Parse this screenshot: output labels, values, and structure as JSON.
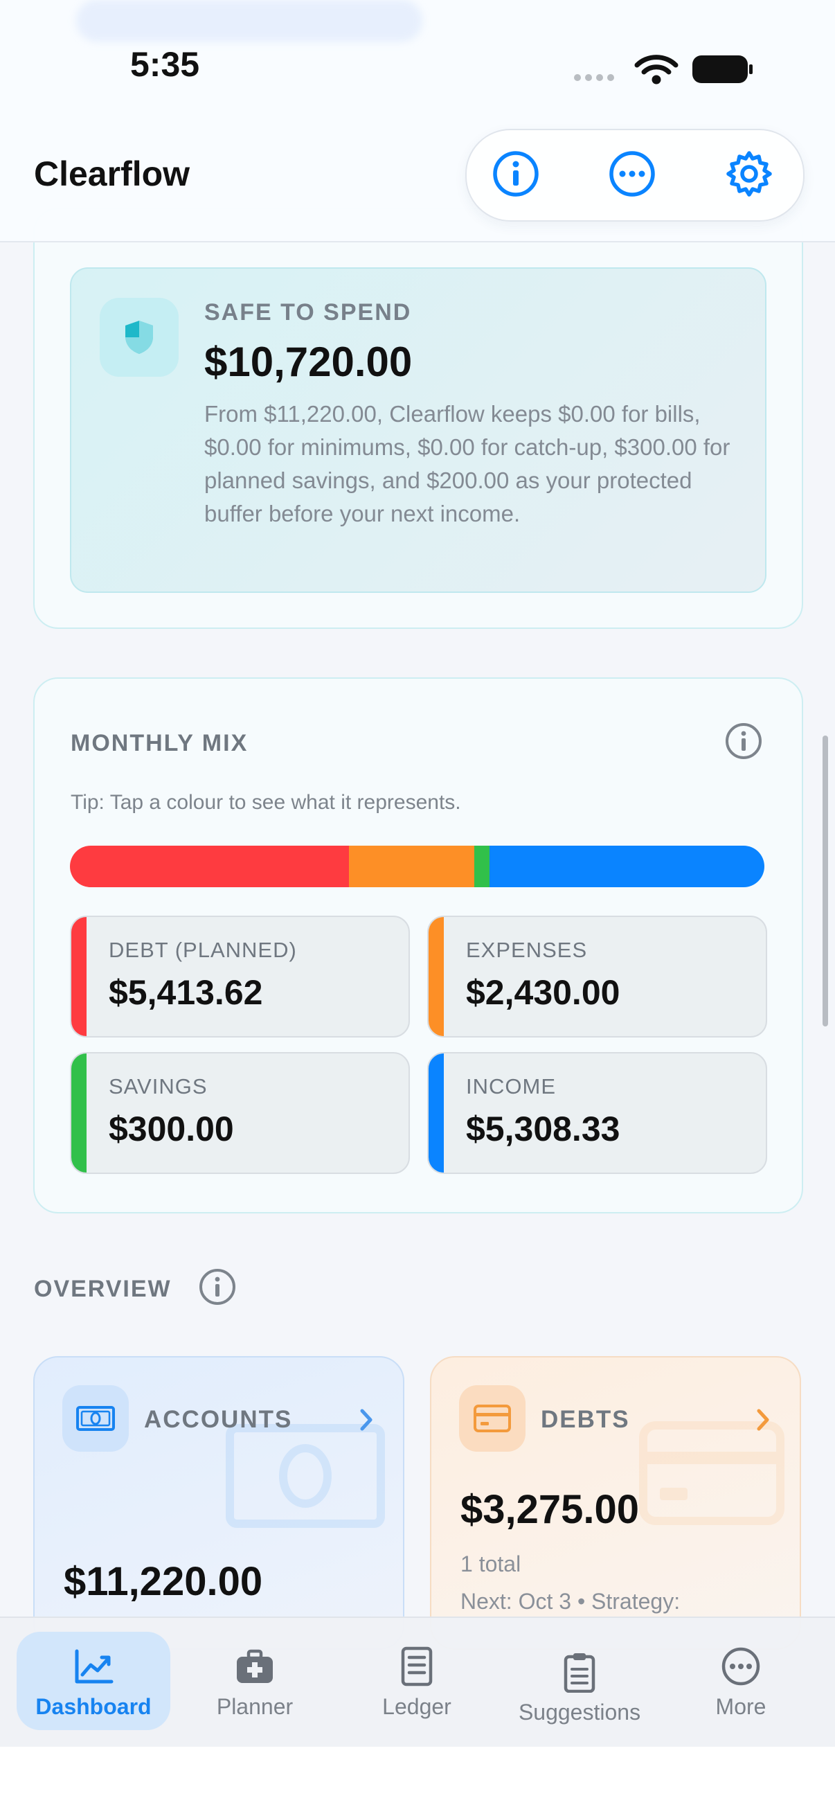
{
  "status_bar": {
    "time": "5:35"
  },
  "header": {
    "title": "Clearflow",
    "buttons": [
      {
        "name": "info",
        "icon": "info-icon"
      },
      {
        "name": "more",
        "icon": "ellipsis-circle-icon"
      },
      {
        "name": "settings",
        "icon": "gear-icon"
      }
    ]
  },
  "safe_to_spend": {
    "label": "SAFE TO SPEND",
    "amount": "$10,720.00",
    "description": "From $11,220.00, Clearflow keeps $0.00 for bills, $0.00 for minimums, $0.00 for catch-up, $300.00 for planned savings, and $200.00 as your protected buffer before your next income.",
    "icon": "shield-icon",
    "accent": "#1fb8c9"
  },
  "monthly_mix": {
    "title": "MONTHLY MIX",
    "tip": "Tip: Tap a colour to see what it represents.",
    "info_icon": "info-icon",
    "segments": [
      {
        "name": "debt",
        "fraction": 0.402,
        "color": "#fe3b40"
      },
      {
        "name": "expenses",
        "fraction": 0.18,
        "color": "#fd8f26"
      },
      {
        "name": "savings",
        "fraction": 0.022,
        "color": "#31c04a"
      },
      {
        "name": "income",
        "fraction": 0.396,
        "color": "#0a84ff"
      }
    ],
    "tiles": [
      {
        "label": "DEBT (PLANNED)",
        "value": "$5,413.62",
        "color": "#fe3b40"
      },
      {
        "label": "EXPENSES",
        "value": "$2,430.00",
        "color": "#fd8f26"
      },
      {
        "label": "SAVINGS",
        "value": "$300.00",
        "color": "#31c04a"
      },
      {
        "label": "INCOME",
        "value": "$5,308.33",
        "color": "#0a84ff"
      }
    ]
  },
  "overview": {
    "label": "OVERVIEW",
    "accounts": {
      "title": "ACCOUNTS",
      "amount": "$11,220.00",
      "icon": "banknote-icon",
      "accent": "#1783f0"
    },
    "debts": {
      "title": "DEBTS",
      "amount": "$3,275.00",
      "count": "1 total",
      "next": "Next: Oct 3 • Strategy:",
      "icon": "credit-card-icon",
      "accent": "#f39a3c"
    }
  },
  "tab_bar": {
    "tabs": [
      {
        "label": "Dashboard",
        "icon": "chart-line-icon",
        "active": true
      },
      {
        "label": "Planner",
        "icon": "medical-kit-icon",
        "active": false
      },
      {
        "label": "Ledger",
        "icon": "ledger-icon",
        "active": false
      },
      {
        "label": "Suggestions",
        "icon": "clipboard-icon",
        "active": false
      },
      {
        "label": "More",
        "icon": "ellipsis-circle-icon",
        "active": false
      }
    ]
  }
}
